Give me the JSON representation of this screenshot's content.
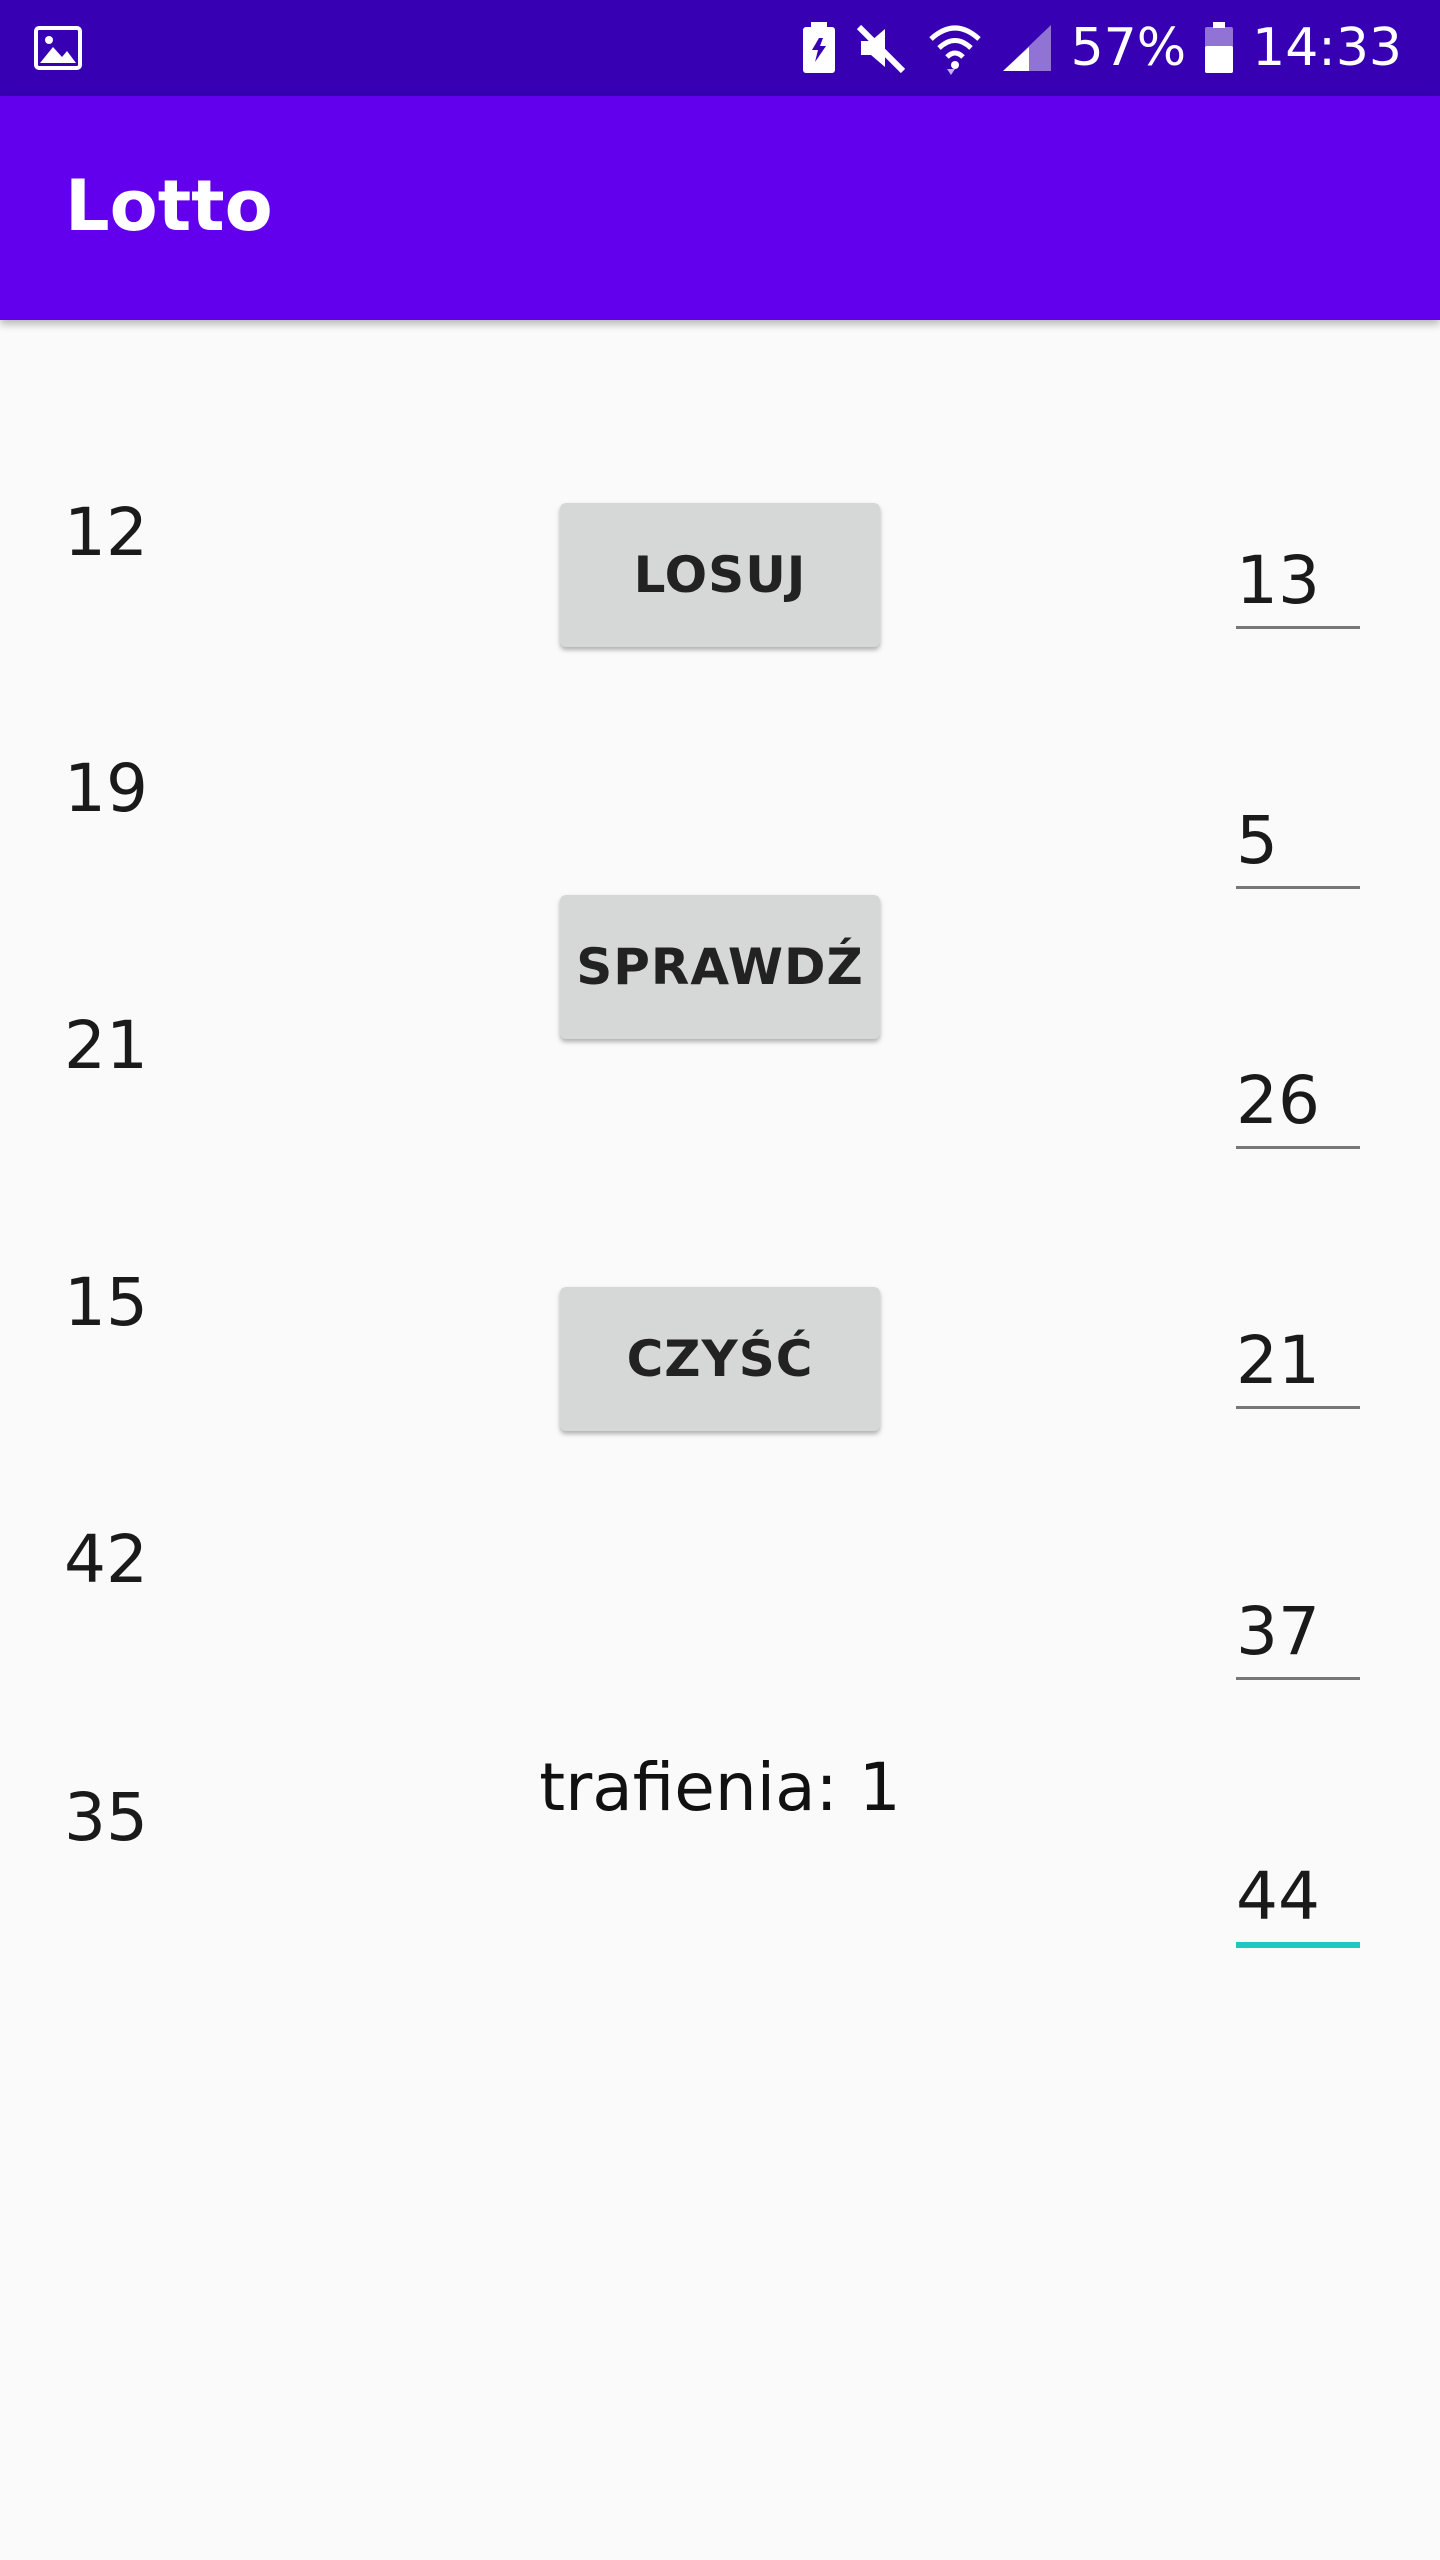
{
  "status_bar": {
    "battery_percent": "57%",
    "time": "14:33",
    "icons": [
      "gallery-icon",
      "battery-saver-icon",
      "mute-icon",
      "wifi-icon",
      "signal-icon",
      "battery-icon"
    ]
  },
  "app_bar": {
    "title": "Lotto"
  },
  "drawn_numbers": [
    "12",
    "19",
    "21",
    "15",
    "42",
    "35"
  ],
  "buttons": {
    "draw_label": "LOSUJ",
    "check_label": "SPRAWDŹ",
    "clear_label": "CZYŚĆ"
  },
  "result": {
    "text": "trafienia: 1"
  },
  "user_numbers": [
    "13",
    "5",
    "26",
    "21",
    "37",
    "44"
  ],
  "colors": {
    "status_bar": "#3700b3",
    "app_bar": "#6200ee",
    "background": "#fafafa",
    "button": "#d6d7d7",
    "focus_underline": "#1ec8c0"
  }
}
